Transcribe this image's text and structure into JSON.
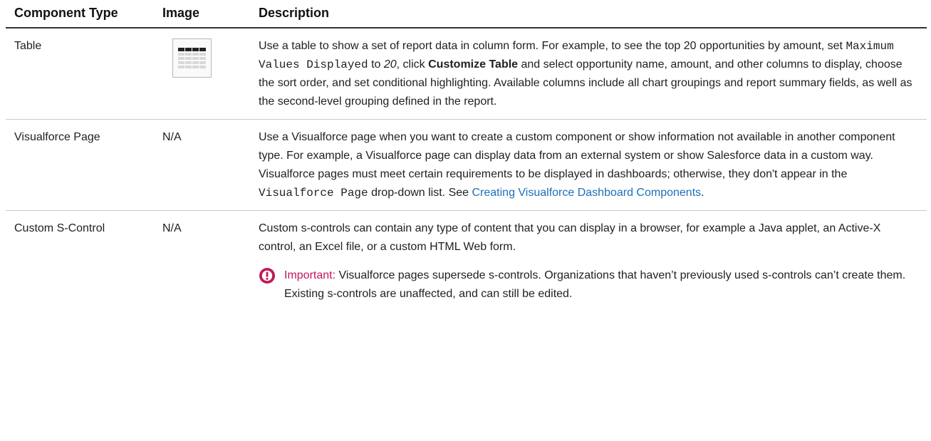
{
  "table": {
    "headers": {
      "type": "Component Type",
      "image": "Image",
      "description": "Description"
    },
    "rows": [
      {
        "type": "Table",
        "image": "",
        "image_icon": "table-thumbnail-icon",
        "description": {
          "t1": "Use a table to show a set of report data in column form. For example, to see the top 20 opportunities by amount, set ",
          "code1": "Maximum Values Displayed",
          "t2": " to ",
          "ital1": "20",
          "t3": ", click ",
          "bold1": "Customize Table",
          "t4": " and select opportunity name, amount, and other columns to display, choose the sort order, and set conditional highlighting. Available columns include all chart groupings and report summary fields, as well as the second-level grouping defined in the report."
        }
      },
      {
        "type": "Visualforce Page",
        "image": "N/A",
        "description": {
          "t1": "Use a Visualforce page when you want to create a custom component or show information not available in another component type. For example, a Visualforce page can display data from an external system or show Salesforce data in a custom way. Visualforce pages must meet certain requirements to be displayed in dashboards; otherwise, they don't appear in the ",
          "code1": "Visualforce Page",
          "t2": " drop-down list. See ",
          "link1": "Creating Visualforce Dashboard Components",
          "t3": "."
        }
      },
      {
        "type": "Custom S-Control",
        "image": "N/A",
        "description": {
          "p1": "Custom s-controls can contain any type of content that you can display in a browser, for example a Java applet, an Active-X control, an Excel file, or a custom HTML Web form.",
          "important_label": "Important:",
          "important_text": " Visualforce pages supersede s-controls. Organizations that haven’t previously used s-controls can’t create them. Existing s-controls are unaffected, and can still be edited."
        }
      }
    ]
  },
  "colors": {
    "important": "#c2185b",
    "link": "#1d6fb8"
  },
  "icons": {
    "important": "important-exclamation-icon"
  }
}
